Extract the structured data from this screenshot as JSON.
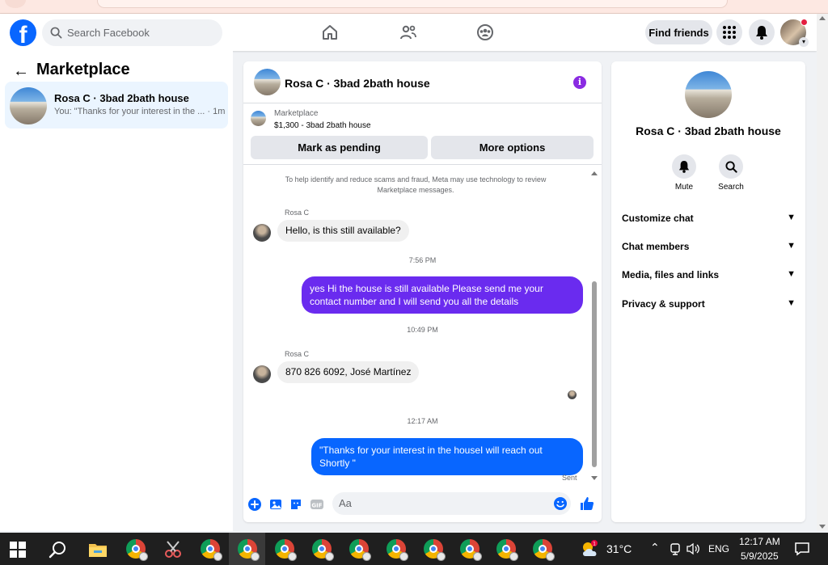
{
  "topbar": {
    "search_placeholder": "Search Facebook",
    "find_friends": "Find friends"
  },
  "sidebar": {
    "title": "Marketplace",
    "back_glyph": "←",
    "conversations": [
      {
        "name": "Rosa C · 3bad 2bath house",
        "preview": "You: \"Thanks for your interest in the ...",
        "time": "· 1m"
      }
    ]
  },
  "chat": {
    "header_name": "Rosa C · 3bad 2bath house",
    "info_glyph": "i",
    "listing": {
      "label": "Marketplace",
      "price_title": "$1,300 - 3bad 2bath house",
      "mark_pending": "Mark as pending",
      "more_options": "More options"
    },
    "notice": "To help identify and reduce scams and fraud, Meta may use technology to review Marketplace messages.",
    "messages": [
      {
        "sender": "Rosa C",
        "text": "Hello, is this still available?"
      },
      {
        "time": "7:56 PM"
      },
      {
        "text": "yes Hi the house is still available Please send me your contact number and I will send you all the details"
      },
      {
        "time": "10:49 PM"
      },
      {
        "sender": "Rosa C",
        "text": "870 826 6092,  José Martínez"
      },
      {
        "time": "12:17 AM"
      },
      {
        "text": "\"Thanks for your interest in the houseI will reach out Shortly \""
      }
    ],
    "sent_label": "Sent",
    "composer_placeholder": "Aa"
  },
  "info_panel": {
    "name": "Rosa C · 3bad 2bath house",
    "actions": [
      "Mute",
      "Search"
    ],
    "rows": [
      "Customize chat",
      "Chat members",
      "Media, files and links",
      "Privacy & support"
    ]
  },
  "taskbar": {
    "temperature": "31°C",
    "language": "ENG",
    "time": "12:17 AM",
    "date": "5/9/2025"
  },
  "colors": {
    "facebook_blue": "#0866ff",
    "outgoing_purple": "#6a2bef",
    "outgoing_blue": "#0866ff",
    "info_purple": "#8a2be2"
  }
}
